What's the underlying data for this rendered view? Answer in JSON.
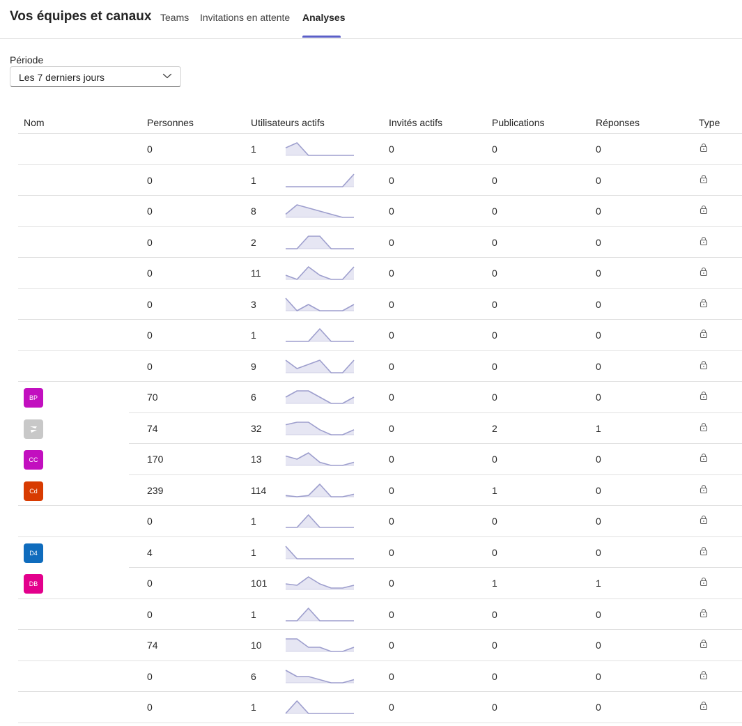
{
  "header": {
    "title": "Vos équipes et canaux",
    "tabs": [
      {
        "label": "Teams"
      },
      {
        "label": "Invitations en attente"
      },
      {
        "label": "Analyses"
      }
    ]
  },
  "filters": {
    "period_label": "Période",
    "period_value": "Les 7 derniers jours"
  },
  "table": {
    "columns": {
      "name": "Nom",
      "people": "Personnes",
      "active_users": "Utilisateurs actifs",
      "active_guests": "Invités actifs",
      "posts": "Publications",
      "replies": "Réponses",
      "type": "Type"
    },
    "type_icon": "lock-icon",
    "accent_color": "#9d9ecd",
    "rows": [
      {
        "avatar": "",
        "avatar_color": "",
        "people": "0",
        "active": "1",
        "guests": "0",
        "posts": "0",
        "replies": "0",
        "trend": [
          0.6,
          1,
          0,
          0,
          0,
          0,
          0
        ]
      },
      {
        "avatar": "",
        "avatar_color": "",
        "people": "0",
        "active": "1",
        "guests": "0",
        "posts": "0",
        "replies": "0",
        "trend": [
          0,
          0,
          0,
          0,
          0,
          0,
          1
        ]
      },
      {
        "avatar": "",
        "avatar_color": "",
        "people": "0",
        "active": "8",
        "guests": "0",
        "posts": "0",
        "replies": "0",
        "trend": [
          1,
          4,
          3,
          2,
          1,
          0,
          0
        ]
      },
      {
        "avatar": "",
        "avatar_color": "",
        "people": "0",
        "active": "2",
        "guests": "0",
        "posts": "0",
        "replies": "0",
        "trend": [
          0,
          0,
          1,
          1,
          0,
          0,
          0
        ]
      },
      {
        "avatar": "",
        "avatar_color": "",
        "people": "0",
        "active": "11",
        "guests": "0",
        "posts": "0",
        "replies": "0",
        "trend": [
          1,
          0,
          3,
          1,
          0,
          0,
          3
        ]
      },
      {
        "avatar": "",
        "avatar_color": "",
        "people": "0",
        "active": "3",
        "guests": "0",
        "posts": "0",
        "replies": "0",
        "trend": [
          2,
          0,
          1,
          0,
          0,
          0,
          1
        ]
      },
      {
        "avatar": "",
        "avatar_color": "",
        "people": "0",
        "active": "1",
        "guests": "0",
        "posts": "0",
        "replies": "0",
        "trend": [
          0,
          0,
          0,
          1,
          0,
          0,
          0
        ]
      },
      {
        "avatar": "",
        "avatar_color": "",
        "people": "0",
        "active": "9",
        "guests": "0",
        "posts": "0",
        "replies": "0",
        "trend": [
          3,
          1,
          2,
          3,
          0,
          0,
          3
        ]
      },
      {
        "avatar": "BP",
        "avatar_color": "#c20fbf",
        "people": "70",
        "active": "6",
        "guests": "0",
        "posts": "0",
        "replies": "0",
        "trend": [
          1,
          2,
          2,
          1,
          0,
          0,
          1
        ]
      },
      {
        "avatar": "",
        "avatar_color": "#c8c8c8",
        "people": "74",
        "active": "32",
        "guests": "0",
        "posts": "2",
        "replies": "1",
        "trend": [
          4,
          5,
          5,
          2,
          0,
          0,
          2
        ]
      },
      {
        "avatar": "CC",
        "avatar_color": "#c20fbf",
        "people": "170",
        "active": "13",
        "guests": "0",
        "posts": "0",
        "replies": "0",
        "trend": [
          3,
          2,
          4,
          1,
          0,
          0,
          1
        ]
      },
      {
        "avatar": "Cd",
        "avatar_color": "#d83b01",
        "people": "239",
        "active": "114",
        "guests": "0",
        "posts": "1",
        "replies": "0",
        "trend": [
          1,
          0,
          1,
          10,
          0,
          0,
          2
        ]
      },
      {
        "avatar": "",
        "avatar_color": "",
        "people": "0",
        "active": "1",
        "guests": "0",
        "posts": "0",
        "replies": "0",
        "trend": [
          0,
          0,
          1,
          0,
          0,
          0,
          0
        ]
      },
      {
        "avatar": "D4",
        "avatar_color": "#0f6cbd",
        "people": "4",
        "active": "1",
        "guests": "0",
        "posts": "0",
        "replies": "0",
        "trend": [
          1,
          0,
          0,
          0,
          0,
          0,
          0
        ]
      },
      {
        "avatar": "DB",
        "avatar_color": "#e3008c",
        "people": "0",
        "active": "101",
        "guests": "0",
        "posts": "1",
        "replies": "1",
        "trend": [
          4,
          3,
          9,
          4,
          1,
          1,
          3
        ]
      },
      {
        "avatar": "",
        "avatar_color": "",
        "people": "0",
        "active": "1",
        "guests": "0",
        "posts": "0",
        "replies": "0",
        "trend": [
          0,
          0,
          1,
          0,
          0,
          0,
          0
        ]
      },
      {
        "avatar": "",
        "avatar_color": "",
        "people": "74",
        "active": "10",
        "guests": "0",
        "posts": "0",
        "replies": "0",
        "trend": [
          3,
          3,
          1,
          1,
          0,
          0,
          1
        ]
      },
      {
        "avatar": "",
        "avatar_color": "",
        "people": "0",
        "active": "6",
        "guests": "0",
        "posts": "0",
        "replies": "0",
        "trend": [
          4,
          2,
          2,
          1,
          0,
          0,
          1
        ]
      },
      {
        "avatar": "",
        "avatar_color": "",
        "people": "0",
        "active": "1",
        "guests": "0",
        "posts": "0",
        "replies": "0",
        "trend": [
          0,
          1,
          0,
          0,
          0,
          0,
          0
        ]
      }
    ]
  }
}
